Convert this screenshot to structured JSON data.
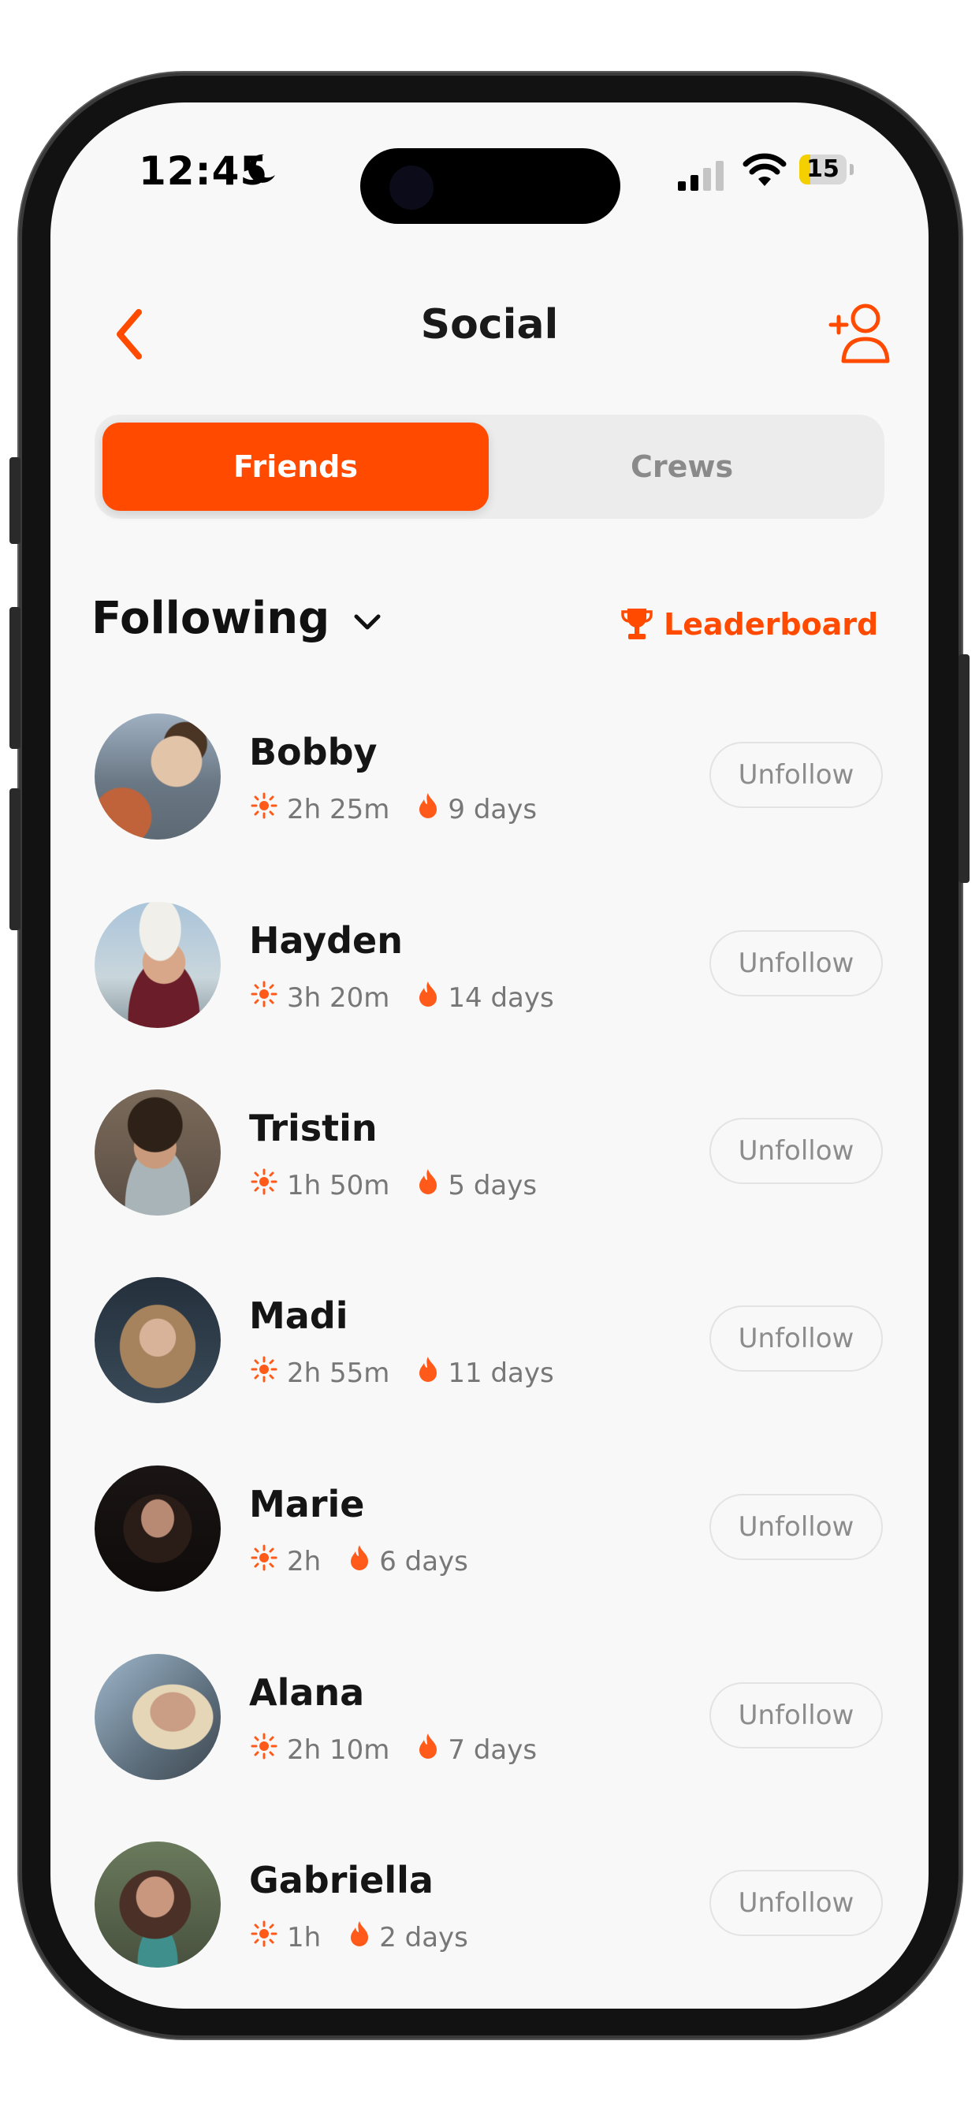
{
  "status_bar": {
    "time": "12:45",
    "battery": "15"
  },
  "header": {
    "title": "Social"
  },
  "tabs": [
    {
      "label": "Friends",
      "active": true
    },
    {
      "label": "Crews",
      "active": false
    }
  ],
  "filter": {
    "label": "Following"
  },
  "leaderboard": {
    "label": "Leaderboard"
  },
  "accent_color": "#ff4a00",
  "friends": [
    {
      "name": "Bobby",
      "time": "2h 25m",
      "streak": "9 days",
      "action": "Unfollow"
    },
    {
      "name": "Hayden",
      "time": "3h 20m",
      "streak": "14 days",
      "action": "Unfollow"
    },
    {
      "name": "Tristin",
      "time": "1h 50m",
      "streak": "5 days",
      "action": "Unfollow"
    },
    {
      "name": "Madi",
      "time": "2h 55m",
      "streak": "11 days",
      "action": "Unfollow"
    },
    {
      "name": "Marie",
      "time": "2h",
      "streak": "6 days",
      "action": "Unfollow"
    },
    {
      "name": "Alana",
      "time": "2h 10m",
      "streak": "7 days",
      "action": "Unfollow"
    },
    {
      "name": "Gabriella",
      "time": "1h",
      "streak": "2 days",
      "action": "Unfollow"
    }
  ]
}
